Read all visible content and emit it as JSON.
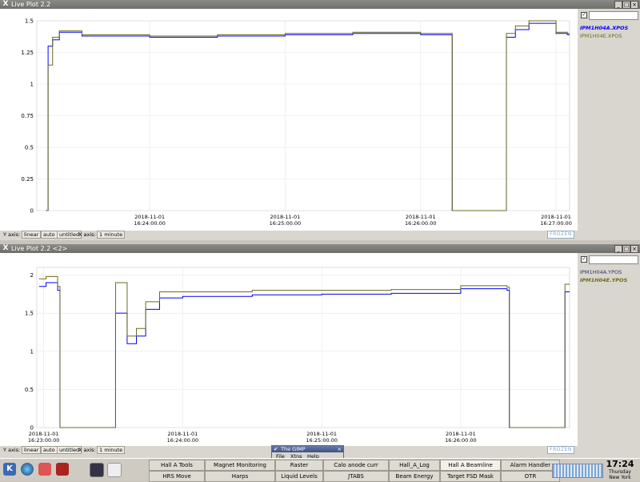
{
  "windows": [
    {
      "title": "Live Plot 2.2",
      "legend": [
        {
          "label": "IPM1H04A.XPOS",
          "color": "#0000ff",
          "bold": true
        },
        {
          "label": "IPM1H04E.XPOS",
          "color": "#6b6b1c",
          "bold": false
        }
      ],
      "y_ticks": [
        "1.5",
        "1.25",
        "1",
        "0.75",
        "0.5",
        "0.25",
        "0"
      ],
      "x_ticks": [
        {
          "date": "2018-11-01",
          "time": "16:24:00.00"
        },
        {
          "date": "2018-11-01",
          "time": "16:25:00.00"
        },
        {
          "date": "2018-11-01",
          "time": "16:26:00.00"
        },
        {
          "date": "2018-11-01",
          "time": "16:27:00.00"
        }
      ],
      "status": {
        "y_axis_label": "Y axis:",
        "scale": "linear",
        "range": "auto",
        "title": "untitled",
        "x_axis_label": "X axis:",
        "x_span": "1 minute",
        "frozen": "FROZEN"
      }
    },
    {
      "title": "Live Plot 2.2 <2>",
      "legend": [
        {
          "label": "IPM1H04A.YPOS",
          "color": "#333366",
          "bold": false
        },
        {
          "label": "IPM1H04E.YPOS",
          "color": "#6b6b1c",
          "bold": true
        }
      ],
      "y_ticks": [
        "2",
        "1.5",
        "1",
        "0.5",
        "0"
      ],
      "x_ticks": [
        {
          "date": "2018-11-01",
          "time": "16:23:00.00"
        },
        {
          "date": "2018-11-01",
          "time": "16:24:00.00"
        },
        {
          "date": "2018-11-01",
          "time": "16:25:00.00"
        },
        {
          "date": "2018-11-01",
          "time": "16:26:00.00"
        }
      ],
      "status": {
        "y_axis_label": "Y axis:",
        "scale": "linear",
        "range": "auto",
        "title": "untitled",
        "x_axis_label": "X axis:",
        "x_span": "1 minute",
        "frozen": "FROZEN"
      }
    }
  ],
  "chart_data": [
    {
      "type": "line",
      "title": "",
      "ylim": [
        0,
        1.5
      ],
      "x_ticks": [
        "2018-11-01 16:24:00.00",
        "2018-11-01 16:25:00.00",
        "2018-11-01 16:26:00.00",
        "2018-11-01 16:27:00.00"
      ],
      "series": [
        {
          "name": "IPM1H04A.XPOS",
          "color": "#0000ff",
          "x": [
            "16:23:14",
            "16:23:15",
            "16:23:17",
            "16:23:20",
            "16:23:30",
            "16:24:00",
            "16:24:30",
            "16:25:00",
            "16:25:30",
            "16:26:00",
            "16:26:10",
            "16:26:14",
            "16:26:34",
            "16:26:38",
            "16:26:42",
            "16:26:48",
            "16:27:00",
            "16:27:05"
          ],
          "values": [
            0,
            1.3,
            1.35,
            1.41,
            1.38,
            1.37,
            1.38,
            1.39,
            1.4,
            1.39,
            1.39,
            0,
            0,
            1.37,
            1.43,
            1.48,
            1.4,
            1.39
          ]
        },
        {
          "name": "IPM1H04E.XPOS",
          "color": "#6b6b1c",
          "x": [
            "16:23:14",
            "16:23:15",
            "16:23:17",
            "16:23:20",
            "16:23:30",
            "16:24:00",
            "16:24:30",
            "16:25:00",
            "16:25:30",
            "16:26:00",
            "16:26:10",
            "16:26:14",
            "16:26:34",
            "16:26:38",
            "16:26:42",
            "16:26:48",
            "16:27:00",
            "16:27:05"
          ],
          "values": [
            0,
            1.15,
            1.37,
            1.42,
            1.39,
            1.38,
            1.39,
            1.4,
            1.41,
            1.4,
            1.4,
            0,
            0,
            1.4,
            1.46,
            1.5,
            1.41,
            1.4
          ]
        }
      ]
    },
    {
      "type": "line",
      "title": "",
      "ylim": [
        0,
        2.1
      ],
      "x_ticks": [
        "2018-11-01 16:23:00.00",
        "2018-11-01 16:24:00.00",
        "2018-11-01 16:25:00.00",
        "2018-11-01 16:26:00.00"
      ],
      "series": [
        {
          "name": "IPM1H04A.YPOS",
          "color": "#0000ff",
          "x": [
            "16:22:58",
            "16:23:01",
            "16:23:06",
            "16:23:07",
            "16:23:30",
            "16:23:31",
            "16:23:36",
            "16:23:40",
            "16:23:44",
            "16:23:50",
            "16:24:00",
            "16:24:30",
            "16:25:00",
            "16:25:30",
            "16:26:00",
            "16:26:20",
            "16:26:21",
            "16:26:41",
            "16:26:45"
          ],
          "values": [
            1.85,
            1.9,
            1.8,
            0,
            0,
            1.5,
            1.1,
            1.2,
            1.55,
            1.7,
            1.72,
            1.74,
            1.75,
            1.76,
            1.82,
            1.8,
            0,
            0,
            1.78
          ]
        },
        {
          "name": "IPM1H04E.YPOS",
          "color": "#6b6b1c",
          "x": [
            "16:22:58",
            "16:23:01",
            "16:23:06",
            "16:23:07",
            "16:23:30",
            "16:23:31",
            "16:23:36",
            "16:23:40",
            "16:23:44",
            "16:23:50",
            "16:24:00",
            "16:24:30",
            "16:25:00",
            "16:25:30",
            "16:26:00",
            "16:26:20",
            "16:26:21",
            "16:26:41",
            "16:26:45"
          ],
          "values": [
            1.95,
            1.98,
            1.85,
            0,
            0,
            1.9,
            1.2,
            1.3,
            1.65,
            1.78,
            1.78,
            1.8,
            1.8,
            1.81,
            1.86,
            1.84,
            0,
            0,
            1.88
          ]
        }
      ]
    }
  ],
  "taskbar": {
    "buttons_row1": [
      "Hall A Tools",
      "Magnet Monitoring",
      "Raster",
      "Calo anode curr",
      "Hall_A_Log",
      "Hall A Beamline",
      "Alarm Handler"
    ],
    "buttons_row2": [
      "HRS Move",
      "Harps",
      "Liquid Levels",
      "JTABS",
      "Beam Energy",
      "Target FSD Mask",
      "OTR"
    ],
    "active": "Hall A Beamline",
    "clock": {
      "time": "17:24",
      "day": "Thursday",
      "location": "New York"
    }
  },
  "gimp": {
    "title": "The GIMP",
    "menu": [
      "File",
      "Xtns",
      "Help"
    ]
  }
}
